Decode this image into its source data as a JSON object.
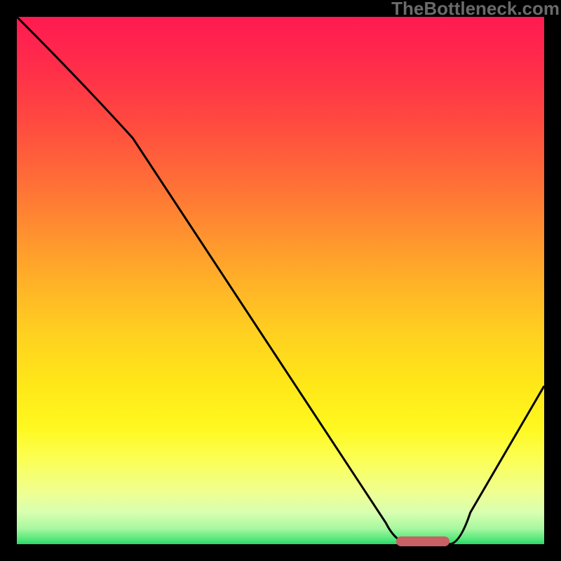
{
  "watermark": "TheBottleneck.com",
  "chart_data": {
    "type": "line",
    "title": "",
    "xlabel": "",
    "ylabel": "",
    "xlim": [
      0,
      100
    ],
    "ylim": [
      0,
      100
    ],
    "series": [
      {
        "name": "bottleneck-curve",
        "x": [
          0,
          10,
          20,
          30,
          40,
          50,
          60,
          70,
          72,
          80,
          85,
          90,
          100
        ],
        "y": [
          100,
          90,
          80,
          70,
          55,
          40,
          25,
          10,
          0,
          0,
          6,
          14,
          30
        ]
      }
    ],
    "optimal_marker": {
      "x_start": 72,
      "x_end": 82,
      "y": 0,
      "color": "#c86064"
    },
    "background_gradient": [
      {
        "stop": 0.0,
        "color": "#ff1a52"
      },
      {
        "stop": 0.1,
        "color": "#ff2e49"
      },
      {
        "stop": 0.2,
        "color": "#ff4a40"
      },
      {
        "stop": 0.3,
        "color": "#ff6a38"
      },
      {
        "stop": 0.4,
        "color": "#ff8d30"
      },
      {
        "stop": 0.5,
        "color": "#ffb028"
      },
      {
        "stop": 0.6,
        "color": "#ffd020"
      },
      {
        "stop": 0.7,
        "color": "#ffe818"
      },
      {
        "stop": 0.78,
        "color": "#fff820"
      },
      {
        "stop": 0.84,
        "color": "#fbff55"
      },
      {
        "stop": 0.9,
        "color": "#f0ff90"
      },
      {
        "stop": 0.94,
        "color": "#d8ffb0"
      },
      {
        "stop": 0.97,
        "color": "#a8f8a0"
      },
      {
        "stop": 0.99,
        "color": "#58e87c"
      },
      {
        "stop": 1.0,
        "color": "#28d868"
      }
    ]
  }
}
